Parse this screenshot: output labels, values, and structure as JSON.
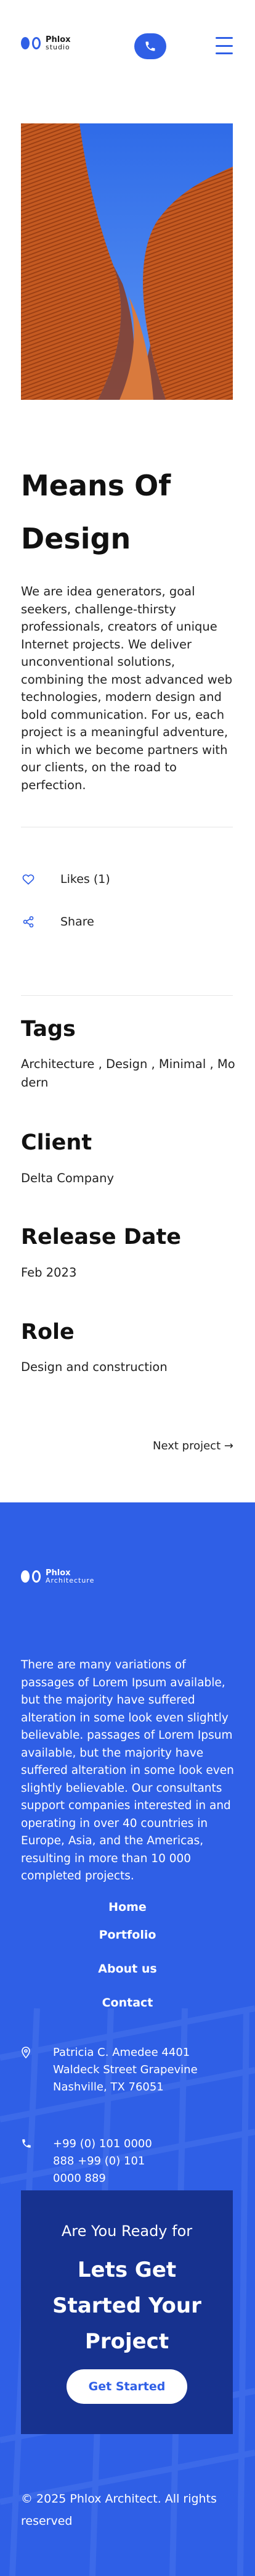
{
  "header": {
    "logo": {
      "name": "Phlox",
      "tagline": "studio"
    },
    "phone_icon": "phone-icon",
    "menu_icon": "hamburger-menu-icon"
  },
  "hero_image": {
    "description": "orange-architecture",
    "sky_color": "#3D7CF0",
    "building_color": "#C45A21"
  },
  "project": {
    "title": "Means Of Design",
    "description": "We are idea generators, goal seekers, challenge-thirsty professionals, creators of unique Internet projects. We deliver unconventional solutions, combining the most advanced web technologies, modern design and bold communication. For us, each project is a meaningful adventure, in which we become partners with our clients, on the road to perfection."
  },
  "actions": {
    "likes_label": "Likes (1)",
    "share_label": "Share"
  },
  "details": {
    "tags_heading": "Tags",
    "tags_value": "Architecture , Design , Minimal , Modern",
    "client_heading": "Client",
    "client_value": "Delta Company",
    "release_heading": "Release Date",
    "release_value": "Feb 2023",
    "role_heading": "Role",
    "role_value": "Design and construction"
  },
  "navigation": {
    "next_label": "Next project →"
  },
  "footer": {
    "logo": {
      "name": "Phlox",
      "tagline": "Architecture"
    },
    "description": "There are many variations of passages of Lorem Ipsum available, but the majority have suffered alteration in some look even slightly believable. passages of Lorem Ipsum available, but the majority have suffered alteration in some look even slightly believable. Our consultants support companies interested in and operating in over 40 countries in Europe, Asia, and the Americas, resulting in more than 10 000 completed projects.",
    "nav": [
      "Home",
      "Portfolio",
      "About us",
      "Contact"
    ],
    "address": "Patricia C. Amedee 4401 Waldeck Street Grapevine Nashville, TX 76051",
    "phones": "+99 (0) 101 0000 888 +99 (0) 101 0000 889",
    "cta": {
      "question": "Are You Ready for",
      "headline": "Lets Get Started Your Project",
      "button": "Get Started"
    },
    "copyright": "© 2025 Phlox Architect. All rights reserved"
  },
  "colors": {
    "accent": "#2F5FE6",
    "cta_bg": "#17328F"
  }
}
